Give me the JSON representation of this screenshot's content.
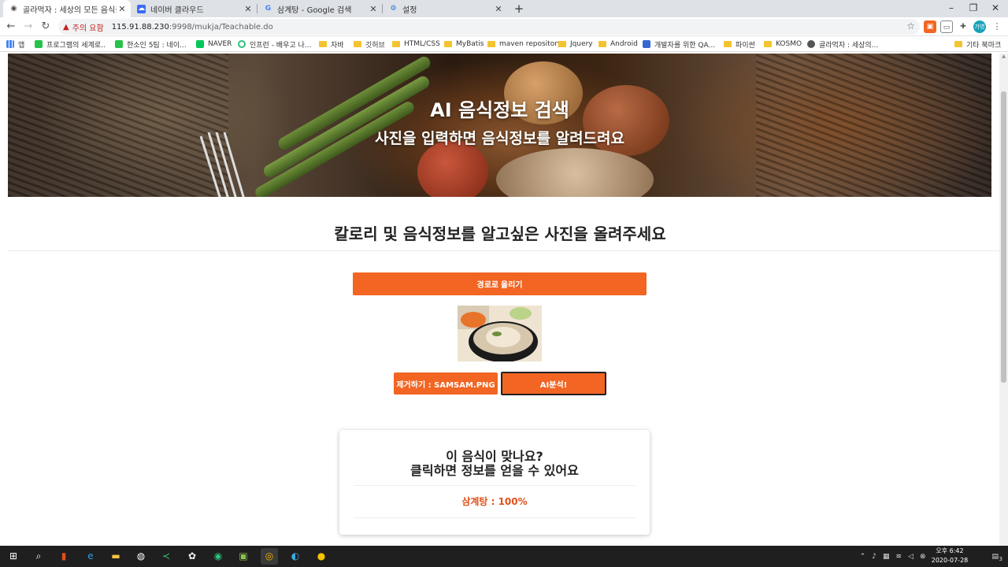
{
  "browser": {
    "tabs": [
      {
        "label": "골라먹자 : 세상의 모든 음식을 :",
        "active": true
      },
      {
        "label": "네이버 클라우드",
        "active": false
      },
      {
        "label": "삼계탕 - Google 검색",
        "active": false
      },
      {
        "label": "설정",
        "active": false
      }
    ],
    "security_warning": "주의 요함",
    "url_host": "115.91.88.230",
    "url_path": ":9998/mukja/Teachable.do",
    "profile_initials": "가영"
  },
  "bookmarks": [
    {
      "label": "앱",
      "icon": "apps-icon"
    },
    {
      "label": "프로그램의 세계로..",
      "icon": "green-icon"
    },
    {
      "label": "한소인 5팀 : 네이...",
      "icon": "green-icon"
    },
    {
      "label": "NAVER",
      "icon": "naver-icon"
    },
    {
      "label": "인프런 - 배우고 나...",
      "icon": "inflearn-icon"
    },
    {
      "label": "자바",
      "icon": "folder-icon"
    },
    {
      "label": "깃허브",
      "icon": "folder-icon"
    },
    {
      "label": "HTML/CSS",
      "icon": "folder-icon"
    },
    {
      "label": "MyBatis",
      "icon": "folder-icon"
    },
    {
      "label": "maven repository",
      "icon": "folder-icon"
    },
    {
      "label": "Jquery",
      "icon": "folder-icon"
    },
    {
      "label": "Android",
      "icon": "folder-icon"
    },
    {
      "label": "개발자를 위한 QA...",
      "icon": "hash-icon"
    },
    {
      "label": "파이썬",
      "icon": "folder-icon"
    },
    {
      "label": "KOSMO",
      "icon": "folder-icon"
    },
    {
      "label": "골라먹자 : 세상의...",
      "icon": "globe-icon"
    },
    {
      "label": "기타 북마크",
      "icon": "folder-icon"
    }
  ],
  "hero": {
    "title": "AI 음식정보 검색",
    "subtitle": "사진을 입력하면 음식정보를 알려드려요"
  },
  "main": {
    "heading": "칼로리 및 음식정보를 알고싶은 사진을 올려주세요",
    "upload_button": "경로로 올리기",
    "remove_button": "제거하기 : SAMSAM.PNG",
    "analyze_button": "AI분석!"
  },
  "result_card": {
    "question_line1": "이 음식이 맞나요?",
    "question_line2": "클릭하면 정보를 얻을 수 있어요",
    "prediction": "삼계탕 : 100%"
  },
  "taskbar": {
    "time": "오후 6:42",
    "date": "2020-07-28",
    "notifications": "3"
  },
  "colors": {
    "accent": "#f26522",
    "result_text": "#e2501b",
    "warning": "#c5221f"
  }
}
